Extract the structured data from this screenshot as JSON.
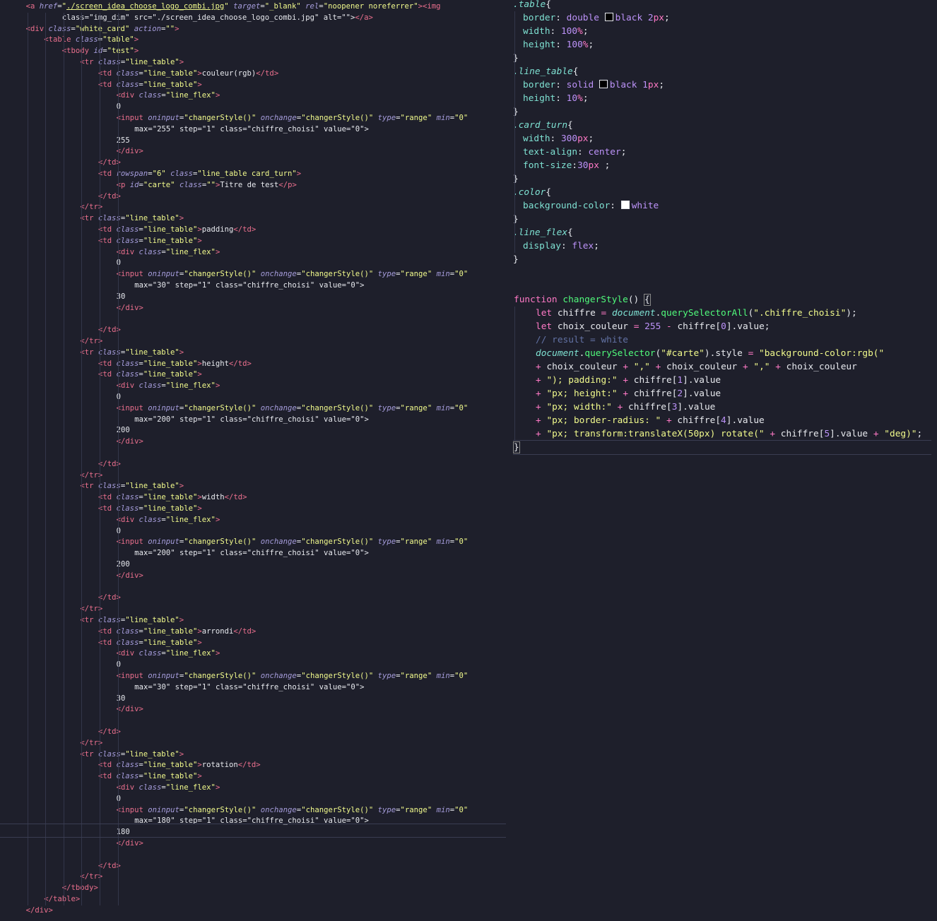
{
  "left_code": [
    "<a href=\"./screen_idea_choose_logo_combi.jpg\" target=\"_blank\" rel=\"noopener noreferrer\"><img",
    "class=\"img_dim\" src=\"./screen_idea_choose_logo_combi.jpg\" alt=\"\"></a>",
    "<div class=\"white_card\" action=\"\">",
    "<table class=\"table\">",
    "<tbody id=\"test\">",
    "<tr class=\"line_table\">",
    "<td class=\"line_table\">couleur(rgb)</td>",
    "<td class=\"line_table\">",
    "<div class=\"line_flex\">",
    "0",
    "<input oninput=\"changerStyle()\" onchange=\"changerStyle()\" type=\"range\" min=\"0\"",
    "max=\"255\" step=\"1\" class=\"chiffre_choisi\" value=\"0\">",
    "255",
    "</div>",
    "</td>",
    "<td rowspan=\"6\" class=\"line_table card_turn\">",
    "<p id=\"carte\" class=\"\">Titre de test</p>",
    "</td>",
    "</tr>",
    "<tr class=\"line_table\">",
    "<td class=\"line_table\">padding</td>",
    "<td class=\"line_table\">",
    "<div class=\"line_flex\">",
    "0",
    "<input oninput=\"changerStyle()\" onchange=\"changerStyle()\" type=\"range\" min=\"0\"",
    "max=\"30\" step=\"1\" class=\"chiffre_choisi\" value=\"0\">",
    "30",
    "</div>",
    "",
    "</td>",
    "</tr>",
    "<tr class=\"line_table\">",
    "<td class=\"line_table\">height</td>",
    "<td class=\"line_table\">",
    "<div class=\"line_flex\">",
    "0",
    "<input oninput=\"changerStyle()\" onchange=\"changerStyle()\" type=\"range\" min=\"0\"",
    "max=\"200\" step=\"1\" class=\"chiffre_choisi\" value=\"0\">",
    "200",
    "</div>",
    "",
    "</td>",
    "</tr>",
    "<tr class=\"line_table\">",
    "<td class=\"line_table\">width</td>",
    "<td class=\"line_table\">",
    "<div class=\"line_flex\">",
    "0",
    "<input oninput=\"changerStyle()\" onchange=\"changerStyle()\" type=\"range\" min=\"0\"",
    "max=\"200\" step=\"1\" class=\"chiffre_choisi\" value=\"0\">",
    "200",
    "</div>",
    "",
    "</td>",
    "</tr>",
    "<tr class=\"line_table\">",
    "<td class=\"line_table\">arrondi</td>",
    "<td class=\"line_table\">",
    "<div class=\"line_flex\">",
    "0",
    "<input oninput=\"changerStyle()\" onchange=\"changerStyle()\" type=\"range\" min=\"0\"",
    "max=\"30\" step=\"1\" class=\"chiffre_choisi\" value=\"0\">",
    "30",
    "</div>",
    "",
    "</td>",
    "</tr>",
    "<tr class=\"line_table\">",
    "<td class=\"line_table\">rotation</td>",
    "<td class=\"line_table\">",
    "<div class=\"line_flex\">",
    "0",
    "<input oninput=\"changerStyle()\" onchange=\"changerStyle()\" type=\"range\" min=\"0\"",
    "max=\"180\" step=\"1\" class=\"chiffre_choisi\" value=\"0\">",
    "180",
    "</div>",
    "",
    "</td>",
    "</tr>",
    "</tbody>",
    "</table>",
    "</div>"
  ],
  "css_code": [
    ".table{",
    "border: double black 2px;",
    "width: 100%;",
    "height: 100%;",
    "}",
    ".line_table{",
    "border: solid black 1px;",
    "height: 10%;",
    "}",
    ".card_turn{",
    "width: 300px;",
    "text-align: center;",
    "font-size:30px ;",
    "}",
    ".color{",
    "background-color: white",
    "}",
    ".line_flex{",
    "display: flex;",
    "}"
  ],
  "js_code": [
    "function changerStyle() {",
    "let chiffre = document.querySelectorAll(\".chiffre_choisi\");",
    "let choix_couleur = 255 - chiffre[0].value;",
    "// result = white",
    "document.querySelector(\"#carte\").style = \"background-color:rgb(\"",
    "+ choix_couleur + \",\" + choix_couleur + \",\" + choix_couleur",
    "+ \"); padding:\" + chiffre[1].value",
    "+ \"px; height:\" + chiffre[2].value",
    "+ \"px; width:\" + chiffre[3].value",
    "+ \"px; border-radius: \" + chiffre[4].value",
    "+ \"px; transform:translateX(50px) rotate(\" + chiffre[5].value + \"deg)\";",
    "}"
  ],
  "colors": {
    "background": "#1e1f2b",
    "tag": "#ea6f8d",
    "attribute": "#a69ddc",
    "string": "#f1fa8c",
    "selector": "#7fe2d3",
    "number": "#bd93f9",
    "keyword": "#ff79c6",
    "function": "#50fa7b",
    "comment": "#6272a4"
  }
}
